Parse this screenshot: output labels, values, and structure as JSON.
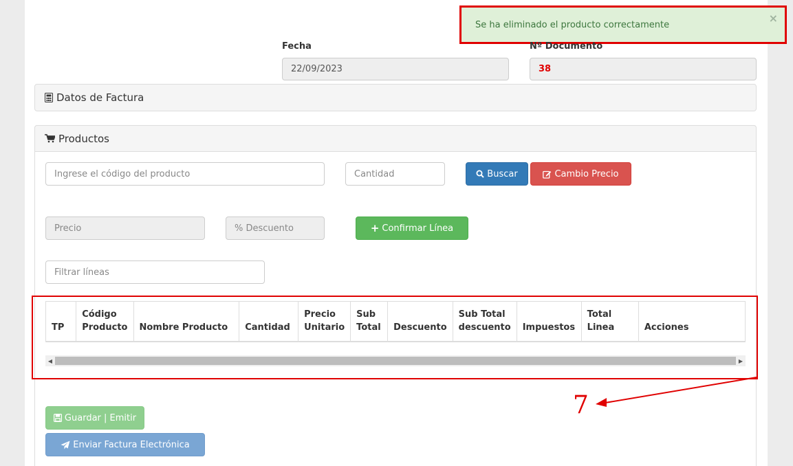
{
  "alert": {
    "message": "Se ha eliminado el producto correctamente",
    "close": "×"
  },
  "header": {
    "fecha_label": "Fecha",
    "fecha_value": "22/09/2023",
    "documento_label": "Nº Documento",
    "documento_value": "38"
  },
  "datos_factura": {
    "title": "Datos de Factura",
    "icon": "calculator-icon"
  },
  "productos": {
    "title": "Productos",
    "icon": "shopping-cart-icon",
    "codigo_placeholder": "Ingrese el código del producto",
    "cantidad_placeholder": "Cantidad",
    "buscar_label": "Buscar",
    "cambio_precio_label": "Cambio Precio",
    "precio_placeholder": "Precio",
    "descuento_placeholder": "% Descuento",
    "confirmar_label": "Confirmar Línea",
    "filtrar_placeholder": "Filtrar líneas"
  },
  "table": {
    "columns": [
      [
        "TP"
      ],
      [
        "Código",
        "Producto"
      ],
      [
        "Nombre Producto"
      ],
      [
        "Cantidad"
      ],
      [
        "Precio",
        "Unitario"
      ],
      [
        "Sub",
        "Total"
      ],
      [
        "Descuento"
      ],
      [
        "Sub Total",
        "descuento"
      ],
      [
        "Impuestos"
      ],
      [
        "Total",
        "Linea"
      ],
      [
        "Acciones"
      ]
    ],
    "rows": []
  },
  "footer": {
    "guardar_label": "Guardar | Emitir",
    "enviar_label": "Enviar Factura Electrónica"
  },
  "annotation": {
    "number": "7"
  },
  "colors": {
    "primary": "#337ab7",
    "danger": "#d9534f",
    "success": "#5cb85c",
    "success_disabled": "#8fcf8f",
    "primary_disabled": "#7aa6d4",
    "annotation_red": "#e00000",
    "document_number_red": "#e00000"
  }
}
